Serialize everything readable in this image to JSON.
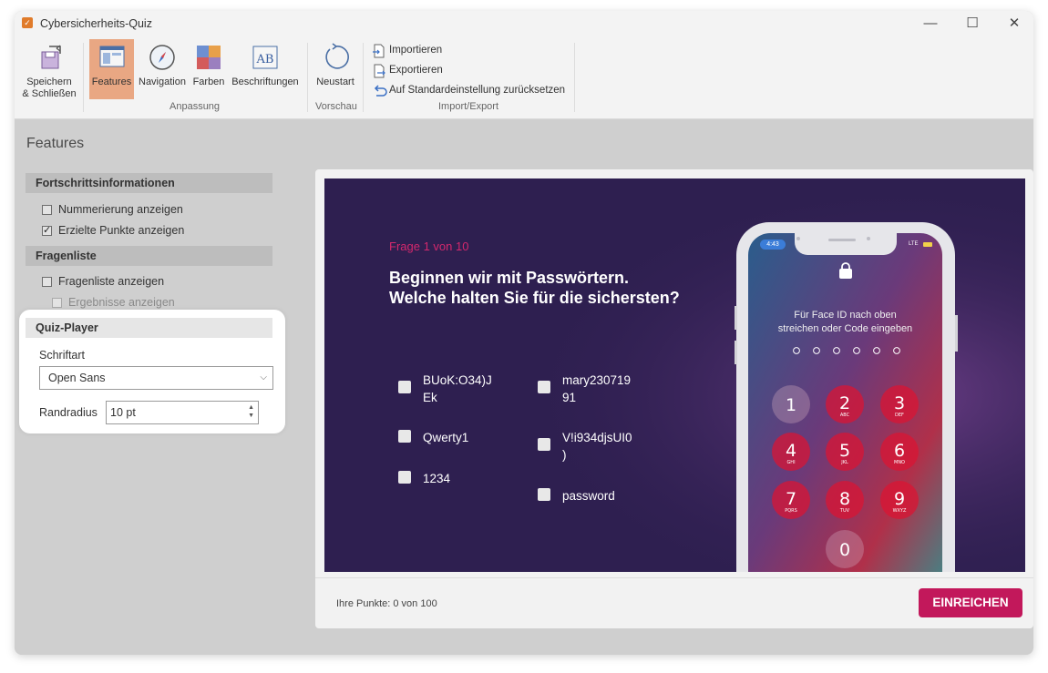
{
  "window": {
    "title": "Cybersicherheits-Quiz",
    "controls": {
      "minimize": "—",
      "maximize": "☐",
      "close": "✕"
    }
  },
  "ribbon": {
    "save_label_1": "Speichern",
    "save_label_2": "& Schließen",
    "features_label": "Features",
    "navigation_label": "Navigation",
    "colors_label": "Farben",
    "labels_label": "Beschriftungen",
    "restart_label": "Neustart",
    "group_customize": "Anpassung",
    "group_preview": "Vorschau",
    "group_import_export": "Import/Export",
    "import_label": "Importieren",
    "export_label": "Exportieren",
    "reset_label": "Auf Standardeinstellung zurücksetzen"
  },
  "left_panel": {
    "title": "Features",
    "progress_section": "Fortschrittsinformationen",
    "show_numbering": "Nummerierung anzeigen",
    "show_numbering_checked": false,
    "show_points": "Erzielte Punkte anzeigen",
    "show_points_checked": true,
    "question_list_section": "Fragenliste",
    "show_question_list": "Fragenliste anzeigen",
    "show_question_list_checked": false,
    "show_results": "Ergebnisse anzeigen",
    "show_results_checked": false,
    "player_section": "Quiz-Player",
    "font_label": "Schriftart",
    "font_value": "Open Sans",
    "border_radius_label": "Randradius",
    "border_radius_value": "10 pt"
  },
  "quiz": {
    "counter": "Frage 1 von 10",
    "question_line1": "Beginnen wir mit Passwörtern.",
    "question_line2": "Welche halten Sie für die sichersten?",
    "options_left": [
      "BUoK:O34)J",
      "Ek",
      "Qwerty1",
      "1234"
    ],
    "options_right": [
      "mary230719",
      "91",
      "V!i934djsUI0",
      ")",
      "password"
    ],
    "score": "Ihre Punkte: 0 von 100",
    "submit": "EINREICHEN"
  },
  "phone": {
    "time": "4:43",
    "network": "LTE",
    "unlock_line1": "Für Face ID nach oben",
    "unlock_line2": "streichen oder Code eingeben",
    "keys": [
      {
        "d": "1",
        "l": ""
      },
      {
        "d": "2",
        "l": "ABC"
      },
      {
        "d": "3",
        "l": "DEF"
      },
      {
        "d": "4",
        "l": "GHI"
      },
      {
        "d": "5",
        "l": "JKL"
      },
      {
        "d": "6",
        "l": "MNO"
      },
      {
        "d": "7",
        "l": "PQRS"
      },
      {
        "d": "8",
        "l": "TUV"
      },
      {
        "d": "9",
        "l": "WXYZ"
      },
      {
        "d": "0",
        "l": ""
      }
    ]
  },
  "colors": {
    "accent": "#c2185b",
    "quiz_bg": "#2e1f50",
    "active_tab": "#e9a783"
  }
}
